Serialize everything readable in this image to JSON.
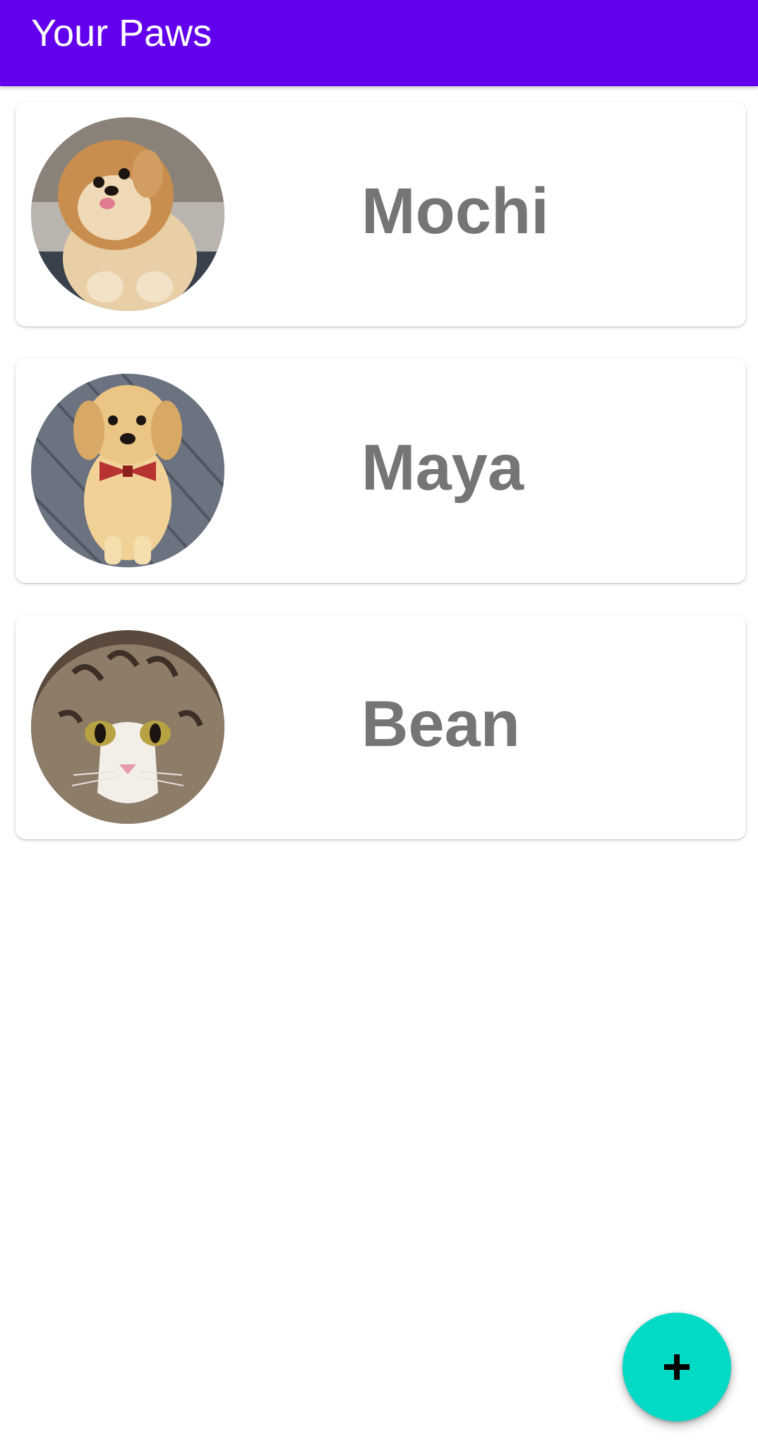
{
  "app_bar": {
    "title": "Your Paws"
  },
  "pets": [
    {
      "name": "Mochi",
      "photo_icon": "pomeranian-dog-photo"
    },
    {
      "name": "Maya",
      "photo_icon": "golden-retriever-puppy-photo"
    },
    {
      "name": "Bean",
      "photo_icon": "tabby-cat-photo"
    }
  ],
  "fab": {
    "icon": "plus-icon"
  },
  "colors": {
    "primary": "#6200ee",
    "accent": "#03dac5",
    "name_text": "#757575"
  }
}
